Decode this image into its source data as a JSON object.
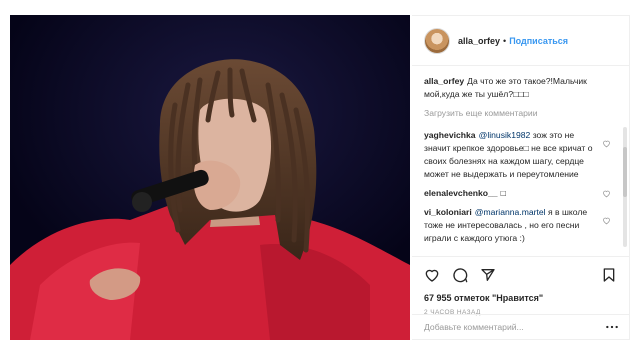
{
  "post": {
    "author": "alla_orfey",
    "follow_label": "Подписаться",
    "separator": "•"
  },
  "caption": {
    "user": "alla_orfey",
    "text": "Да что же это такое?!Мальчик мой,куда же ты ушёл?□□□"
  },
  "load_more_label": "Загрузить еще комментарии",
  "comments": [
    {
      "user": "yaghevichka",
      "mention": "@linusik1982",
      "text": " зож это не значит крепкое здоровье□ не все кричат о своих болезнях на каждом шагу, сердце может не выдержать и переутомление"
    },
    {
      "user": "elenalevchenko__",
      "mention": "",
      "text": "□"
    },
    {
      "user": "vi_koloniari",
      "mention": "@marianna.martel",
      "text": " я в школе тоже не интересовалась , но его песни играли с каждого утюга :)"
    }
  ],
  "likes_text": "67 955 отметок \"Нравится\"",
  "time_text": "2 часов назад",
  "add_comment_placeholder": "Добавьте комментарий...",
  "icons": {
    "like": "heart-icon",
    "comment": "comment-bubble-icon",
    "share": "share-icon",
    "save": "bookmark-icon",
    "more": "more-options-icon"
  },
  "colors": {
    "accent": "#3897f0",
    "mention": "#003569",
    "muted": "#999999",
    "video_background": "#07061e",
    "shirt": "#d8213a"
  }
}
